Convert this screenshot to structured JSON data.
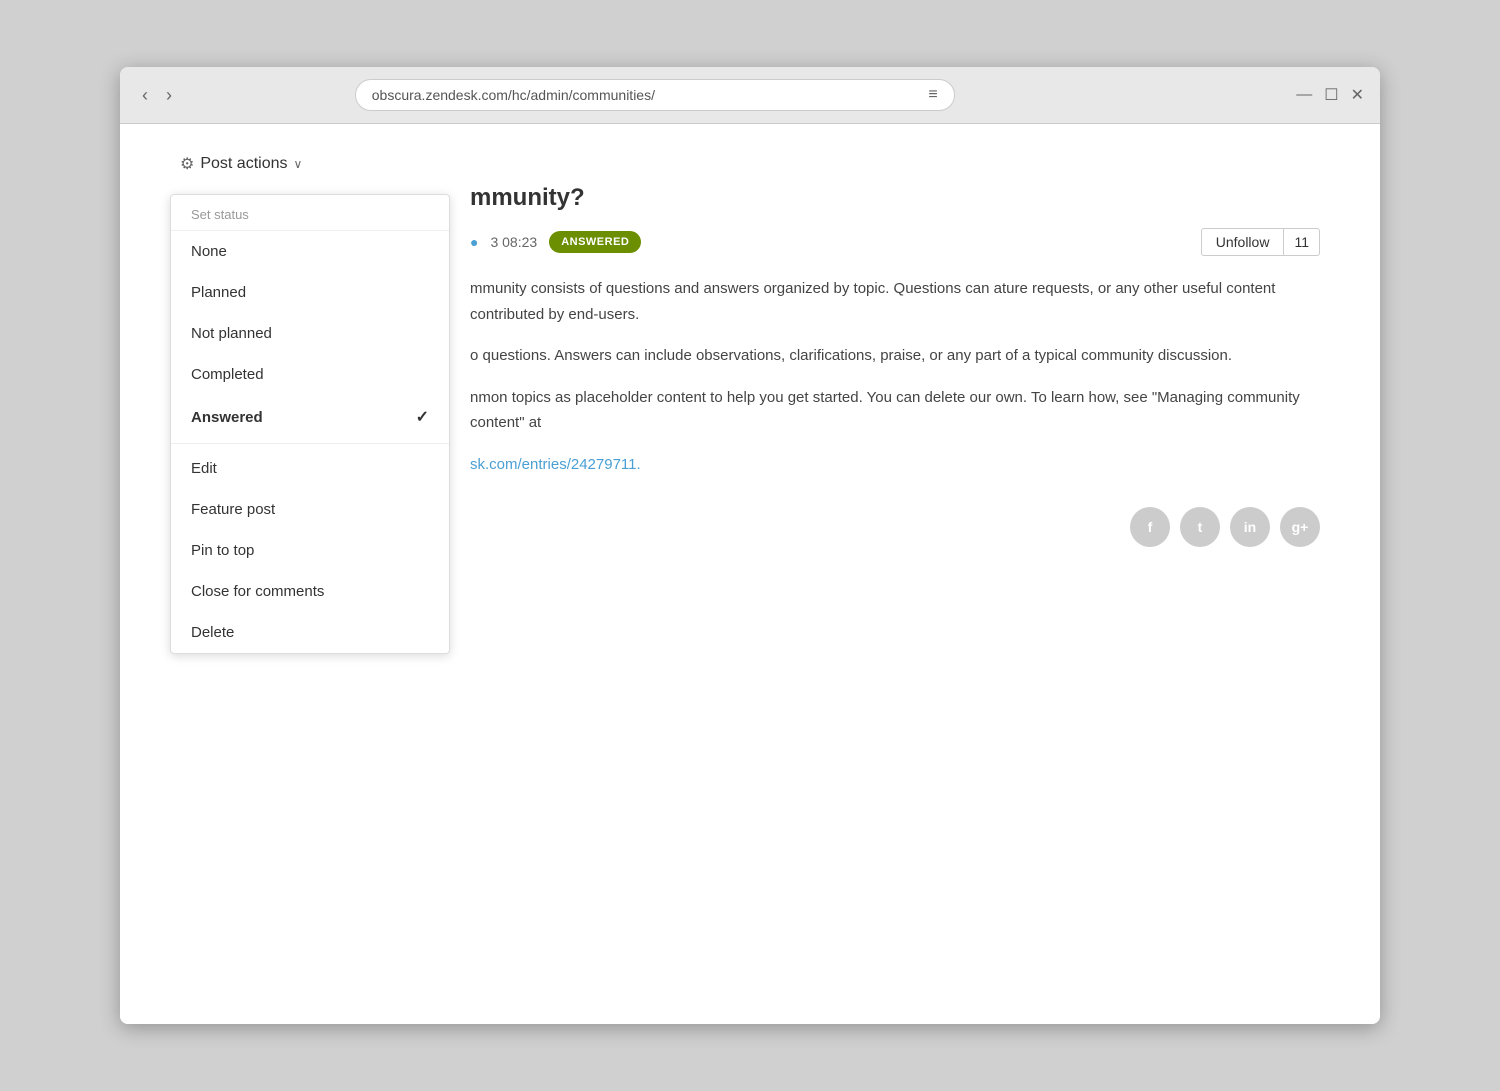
{
  "browser": {
    "url": "obscura.zendesk.com/hc/admin/communities/",
    "nav_back": "‹",
    "nav_forward": "›",
    "hamburger": "≡",
    "minimize": "—",
    "maximize": "☐",
    "close": "✕"
  },
  "post_actions": {
    "trigger_label": "Post actions",
    "chevron": "∨",
    "dropdown": {
      "section_label": "Set status",
      "items": [
        {
          "id": "none",
          "label": "None",
          "active": false
        },
        {
          "id": "planned",
          "label": "Planned",
          "active": false
        },
        {
          "id": "not-planned",
          "label": "Not planned",
          "active": false
        },
        {
          "id": "completed",
          "label": "Completed",
          "active": false
        },
        {
          "id": "answered",
          "label": "Answered",
          "active": true
        }
      ],
      "action_items": [
        {
          "id": "edit",
          "label": "Edit"
        },
        {
          "id": "feature-post",
          "label": "Feature post"
        },
        {
          "id": "pin-to-top",
          "label": "Pin to top"
        },
        {
          "id": "close-for-comments",
          "label": "Close for comments"
        },
        {
          "id": "delete",
          "label": "Delete"
        }
      ]
    }
  },
  "post": {
    "title": "mmunity?",
    "author_link": "",
    "date": "3 08:23",
    "status_badge": "ANSWERED",
    "unfollow_label": "Unfollow",
    "follower_count": "11",
    "body_paragraphs": [
      "mmunity consists of questions and answers organized by topic. Questions can ature requests, or any other useful content contributed by end-users.",
      "o questions. Answers can include observations, clarifications, praise, or any part of a typical community discussion.",
      "nmon topics as placeholder content to help you get started. You can delete our own. To learn how, see \"Managing community content\" at"
    ],
    "link_text": "sk.com/entries/24279711.",
    "link_url": "#"
  },
  "social": {
    "facebook_label": "f",
    "twitter_label": "t",
    "linkedin_label": "in",
    "googleplus_label": "g+"
  }
}
